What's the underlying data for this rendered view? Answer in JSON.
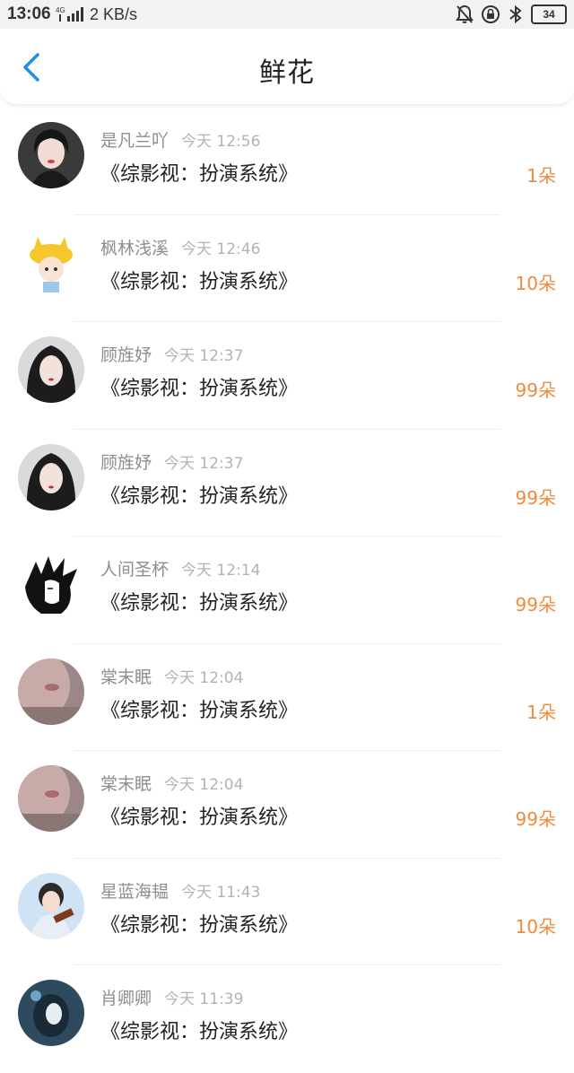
{
  "status": {
    "time": "13:06",
    "net_type": "4G",
    "speed": "2 KB/s",
    "battery": "34"
  },
  "header": {
    "title": "鲜花"
  },
  "items": [
    {
      "name": "是凡兰吖",
      "time": "今天 12:56",
      "book": "《综影视：扮演系统》",
      "count": "1朵",
      "avatar": "avatar-1"
    },
    {
      "name": "枫林浅溪",
      "time": "今天 12:46",
      "book": "《综影视：扮演系统》",
      "count": "10朵",
      "avatar": "avatar-2"
    },
    {
      "name": "顾旌妤",
      "time": "今天 12:37",
      "book": "《综影视：扮演系统》",
      "count": "99朵",
      "avatar": "avatar-3"
    },
    {
      "name": "顾旌妤",
      "time": "今天 12:37",
      "book": "《综影视：扮演系统》",
      "count": "99朵",
      "avatar": "avatar-3"
    },
    {
      "name": "人间圣杯",
      "time": "今天 12:14",
      "book": "《综影视：扮演系统》",
      "count": "99朵",
      "avatar": "avatar-4"
    },
    {
      "name": "棠末眠",
      "time": "今天 12:04",
      "book": "《综影视：扮演系统》",
      "count": "1朵",
      "avatar": "avatar-5"
    },
    {
      "name": "棠末眠",
      "time": "今天 12:04",
      "book": "《综影视：扮演系统》",
      "count": "99朵",
      "avatar": "avatar-5"
    },
    {
      "name": "星蓝海韫",
      "time": "今天 11:43",
      "book": "《综影视：扮演系统》",
      "count": "10朵",
      "avatar": "avatar-6"
    },
    {
      "name": "肖卿卿",
      "time": "今天 11:39",
      "book": "《综影视：扮演系统》",
      "count": "",
      "avatar": "avatar-7"
    }
  ],
  "colors": {
    "accent": "#1e90e6",
    "count": "#f08a3c",
    "name": "#8e8e8e",
    "time": "#b3b3b3"
  }
}
